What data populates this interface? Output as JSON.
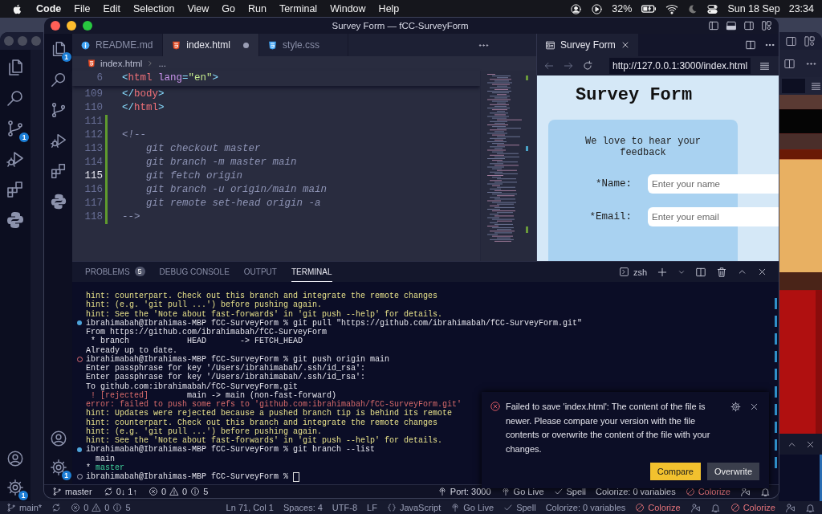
{
  "menubar": {
    "app": "Code",
    "menus": [
      "File",
      "Edit",
      "Selection",
      "View",
      "Go",
      "Run",
      "Terminal",
      "Window",
      "Help"
    ],
    "battery": "32%",
    "date": "Sun 18 Sep",
    "time": "23:34"
  },
  "back_window": {
    "source_control_badge": "1",
    "manage_badge": "1",
    "status_bar": {
      "branch": "main*",
      "errors": "0",
      "warnings": "0",
      "infos": "5",
      "items": [
        {
          "text": "Ln 71, Col 1",
          "kind": "plain"
        },
        {
          "text": "Spaces: 4",
          "kind": "plain"
        },
        {
          "text": "UTF-8",
          "kind": "plain"
        },
        {
          "text": "LF",
          "kind": "plain"
        },
        {
          "text": "JavaScript",
          "kind": "language"
        },
        {
          "text": "Go Live",
          "kind": "live"
        },
        {
          "text": "Spell",
          "kind": "spell"
        },
        {
          "text": "Colorize: 0 variables",
          "kind": "plain"
        },
        {
          "text": "Colorize",
          "kind": "colorize"
        },
        {
          "kind": "feedback"
        },
        {
          "kind": "bell"
        },
        {
          "text": "Colorize",
          "kind": "colorize"
        },
        {
          "kind": "feedback"
        },
        {
          "kind": "bell"
        }
      ]
    }
  },
  "window": {
    "title": "Survey Form — fCC-SurveyForm",
    "explorer_badge": "1",
    "manage_badge": "1"
  },
  "editor": {
    "tabs": [
      {
        "label": "README.md",
        "kind": "info",
        "selected": false,
        "modified": false
      },
      {
        "label": "index.html",
        "kind": "html",
        "selected": true,
        "modified": true
      },
      {
        "label": "style.css",
        "kind": "css",
        "selected": false,
        "modified": false
      }
    ],
    "breadcrumb": {
      "file": "index.html",
      "rest": "..."
    },
    "sticky_line": {
      "number": "6",
      "tokens": [
        {
          "text": "<",
          "kind": "punct"
        },
        {
          "text": "html",
          "kind": "tag"
        },
        {
          "text": " lang",
          "kind": "attr"
        },
        {
          "text": "=",
          "kind": "punct"
        },
        {
          "text": "\"en\"",
          "kind": "string"
        },
        {
          "text": ">",
          "kind": "punct"
        }
      ]
    },
    "lines": [
      {
        "number": "109",
        "current": false,
        "added": false,
        "tokens": [
          {
            "text": "</",
            "kind": "punct"
          },
          {
            "text": "body",
            "kind": "tag"
          },
          {
            "text": ">",
            "kind": "punct"
          }
        ]
      },
      {
        "number": "110",
        "current": false,
        "added": false,
        "tokens": [
          {
            "text": "</",
            "kind": "punct"
          },
          {
            "text": "html",
            "kind": "tag"
          },
          {
            "text": ">",
            "kind": "punct"
          }
        ]
      },
      {
        "number": "111",
        "current": false,
        "added": true
      },
      {
        "number": "112",
        "current": false,
        "added": true,
        "tokens": [
          {
            "text": "<!--",
            "kind": "comment"
          }
        ]
      },
      {
        "number": "113",
        "current": false,
        "added": true,
        "tokens": [
          {
            "text": "    git checkout master",
            "kind": "comment"
          }
        ]
      },
      {
        "number": "114",
        "current": false,
        "added": true,
        "tokens": [
          {
            "text": "    git branch -m master main",
            "kind": "comment"
          }
        ]
      },
      {
        "number": "115",
        "current": true,
        "added": true,
        "tokens": [
          {
            "text": "    git fetch origin",
            "kind": "comment"
          }
        ]
      },
      {
        "number": "116",
        "current": false,
        "added": true,
        "tokens": [
          {
            "text": "    git branch -u origin/main main",
            "kind": "comment"
          }
        ]
      },
      {
        "number": "117",
        "current": false,
        "added": true,
        "tokens": [
          {
            "text": "    git remote set-head origin -a",
            "kind": "comment"
          }
        ]
      },
      {
        "number": "118",
        "current": false,
        "added": true,
        "tokens": [
          {
            "text": "-->",
            "kind": "comment"
          }
        ]
      }
    ]
  },
  "preview": {
    "tab": "Survey Form",
    "url": "http://127.0.0.1:3000/index.html",
    "page": {
      "title": "Survey Form",
      "intro": "We love to hear your feedback",
      "fields": [
        {
          "label": "*Name:",
          "placeholder": "Enter your name"
        },
        {
          "label": "*Email:",
          "placeholder": "Enter your email"
        }
      ]
    }
  },
  "panel": {
    "tabs": [
      {
        "label": "PROBLEMS",
        "badge": "5",
        "selected": false
      },
      {
        "label": "DEBUG CONSOLE",
        "selected": false
      },
      {
        "label": "OUTPUT",
        "selected": false
      },
      {
        "label": "TERMINAL",
        "selected": true
      }
    ],
    "shell": "zsh",
    "terminal": [
      {
        "parts": [
          {
            "text": "hint: counterpart. Check out this branch and integrate the remote changes",
            "kind": "hint"
          }
        ]
      },
      {
        "parts": [
          {
            "text": "hint: (e.g. 'git pull ...') before pushing again.",
            "kind": "hint"
          }
        ]
      },
      {
        "parts": [
          {
            "text": "hint: See the 'Note about fast-forwards' in 'git push --help' for details.",
            "kind": "hint"
          }
        ]
      },
      {
        "kind": "success",
        "parts": [
          {
            "text": "ibrahimabah@Ibrahimas-MBP fCC-SurveyForm % git pull \"https://github.com/ibrahimabah/fCC-SurveyForm.git\"",
            "kind": "plain"
          }
        ]
      },
      {
        "parts": [
          {
            "text": "From https://github.com/ibrahimabah/fCC-SurveyForm",
            "kind": "plain"
          }
        ]
      },
      {
        "parts": [
          {
            "text": " * branch            HEAD       -> FETCH_HEAD",
            "kind": "plain"
          }
        ]
      },
      {
        "parts": [
          {
            "text": "Already up to date.",
            "kind": "plain"
          }
        ]
      },
      {
        "kind": "error",
        "parts": [
          {
            "text": "ibrahimabah@Ibrahimas-MBP fCC-SurveyForm % git push origin main",
            "kind": "plain"
          }
        ]
      },
      {
        "parts": [
          {
            "text": "Enter passphrase for key '/Users/ibrahimabah/.ssh/id_rsa':",
            "kind": "plain"
          }
        ]
      },
      {
        "parts": [
          {
            "text": "Enter passphrase for key '/Users/ibrahimabah/.ssh/id_rsa':",
            "kind": "plain"
          }
        ]
      },
      {
        "parts": [
          {
            "text": "To github.com:ibrahimabah/fCC-SurveyForm.git",
            "kind": "plain"
          }
        ]
      },
      {
        "parts": [
          {
            "text": " ! [rejected]",
            "kind": "error"
          },
          {
            "text": "        main -> main (non-fast-forward)",
            "kind": "plain"
          }
        ]
      },
      {
        "parts": [
          {
            "text": "error: failed to push some refs to 'github.com:ibrahimabah/fCC-SurveyForm.git'",
            "kind": "error"
          }
        ]
      },
      {
        "parts": [
          {
            "text": "hint: Updates were rejected because a pushed branch tip is behind its remote",
            "kind": "hint"
          }
        ]
      },
      {
        "parts": [
          {
            "text": "hint: counterpart. Check out this branch and integrate the remote changes",
            "kind": "hint"
          }
        ]
      },
      {
        "parts": [
          {
            "text": "hint: (e.g. 'git pull ...') before pushing again.",
            "kind": "hint"
          }
        ]
      },
      {
        "parts": [
          {
            "text": "hint: See the 'Note about fast-forwards' in 'git push --help' for details.",
            "kind": "hint"
          }
        ]
      },
      {
        "kind": "success",
        "parts": [
          {
            "text": "ibrahimabah@Ibrahimas-MBP fCC-SurveyForm % git branch --list",
            "kind": "plain"
          }
        ]
      },
      {
        "parts": [
          {
            "text": "  main",
            "kind": "plain"
          }
        ]
      },
      {
        "parts": [
          {
            "text": "* ",
            "kind": "plain"
          },
          {
            "text": "master",
            "kind": "branch"
          }
        ]
      },
      {
        "kind": "pending",
        "cursor": true,
        "parts": [
          {
            "text": "ibrahimabah@Ibrahimas-MBP fCC-SurveyForm %",
            "kind": "plain"
          }
        ]
      }
    ]
  },
  "notification": {
    "message": "Failed to save 'index.html': The content of the file is newer. Please compare your version with the file contents or overwrite the content of the file with your changes.",
    "buttons": [
      {
        "label": "Compare",
        "primary": true
      },
      {
        "label": "Overwrite",
        "primary": false
      }
    ]
  },
  "status_bar": {
    "branch": "master",
    "sync": "0↓ 1↑",
    "errors": "0",
    "warnings": "0",
    "infos": "5",
    "items": [
      {
        "text": "Port: 3000",
        "kind": "port"
      },
      {
        "text": "Go Live",
        "kind": "live"
      },
      {
        "text": "Spell",
        "kind": "spell"
      },
      {
        "text": "Colorize: 0 variables",
        "kind": "plain"
      },
      {
        "text": "Colorize",
        "kind": "colorize"
      },
      {
        "kind": "feedback"
      },
      {
        "kind": "bell"
      }
    ]
  }
}
